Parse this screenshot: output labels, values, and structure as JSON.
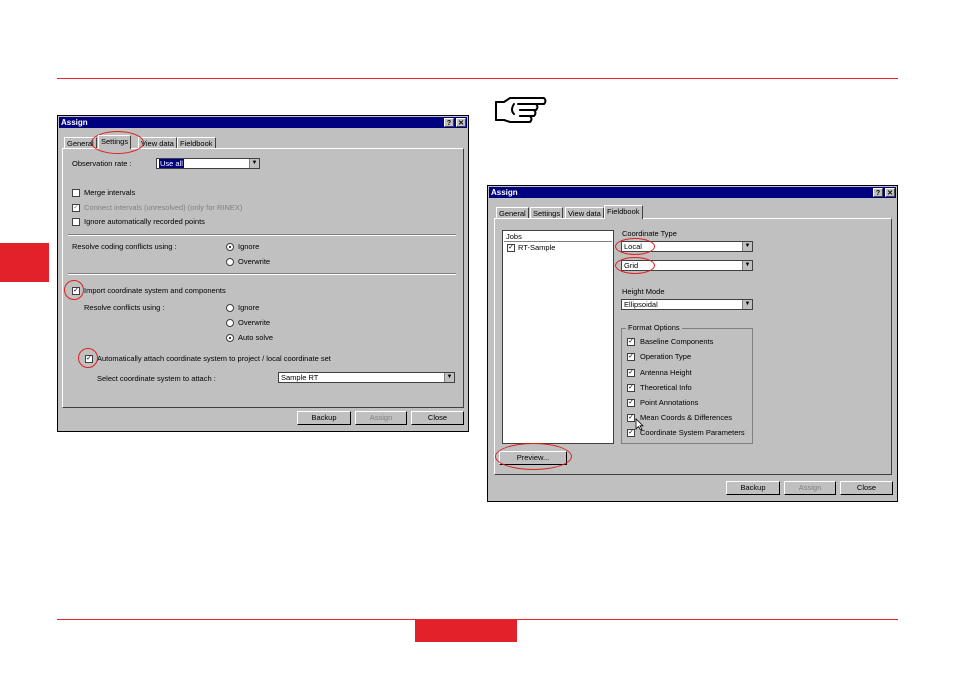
{
  "colors": {
    "accent_red": "#e2212b",
    "titlebar": "#000080",
    "dialog_bg": "#c0c0c0"
  },
  "note_icon": "pointing-hand-icon",
  "left_dialog": {
    "title": "Assign",
    "title_buttons": [
      "?",
      "✕"
    ],
    "tabs": [
      "General",
      "Settings",
      "View data",
      "Fieldbook"
    ],
    "active_tab": "Settings",
    "observation_rate_label": "Observation rate :",
    "observation_rate_value": "Use all",
    "merge_intervals": "Merge intervals",
    "connect_intervals": "Connect intervals (unresolved) (only for RINEX)",
    "ignore_auto_points": "Ignore automatically recorded points",
    "resolve_coding_label": "Resolve coding conflicts using :",
    "coding_options": [
      "Ignore",
      "Overwrite"
    ],
    "import_coord": "Import coordinate system and components",
    "resolve_conflicts_label": "Resolve conflicts using :",
    "conflict_options": [
      "Ignore",
      "Overwrite",
      "Auto solve"
    ],
    "auto_attach": "Automatically attach coordinate system to project / local coordinate set",
    "select_coord_label": "Select coordinate system to attach :",
    "select_coord_value": "Sample RT",
    "buttons": [
      "Backup",
      "Assign",
      "Close"
    ]
  },
  "right_dialog": {
    "title": "Assign",
    "title_buttons": [
      "?",
      "✕"
    ],
    "tabs": [
      "General",
      "Settings",
      "View data",
      "Fieldbook"
    ],
    "active_tab": "Fieldbook",
    "jobs_header": "Jobs",
    "jobs": [
      "RT-Sample"
    ],
    "coord_type_label": "Coordinate Type",
    "coord_type_value": "Local",
    "coord_type_value2": "Grid",
    "height_mode_label": "Height Mode",
    "height_mode_value": "Ellipsoidal",
    "format_options_label": "Format Options",
    "format_options": [
      "Baseline Components",
      "Operation Type",
      "Antenna Height",
      "Theoretical Info",
      "Point Annotations",
      "Mean Coords & Differences",
      "Coordinate System Parameters"
    ],
    "preview_button": "Preview...",
    "buttons": [
      "Backup",
      "Assign",
      "Close"
    ]
  }
}
